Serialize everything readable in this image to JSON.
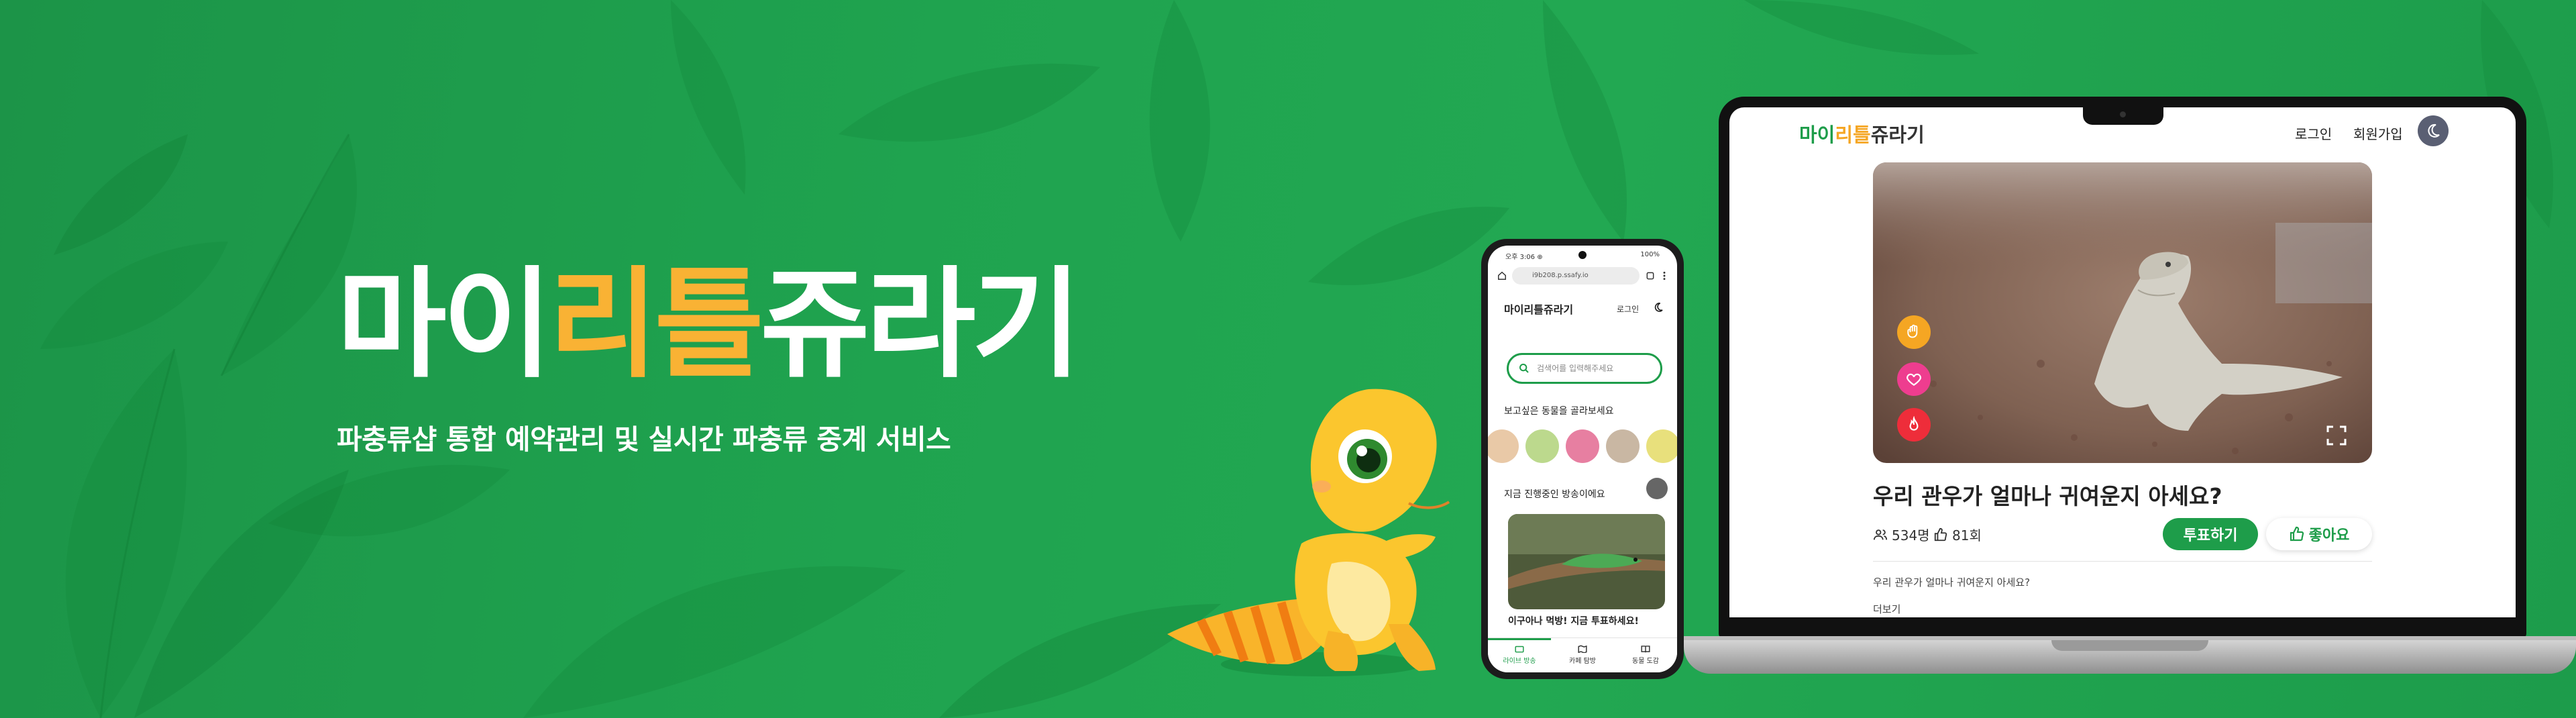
{
  "hero": {
    "title_part1": "마이",
    "title_part2": "리틀",
    "title_part3": "쥬라기",
    "subtitle": "파충류샵 통합 예약관리 및 실시간 파충류 중계 서비스"
  },
  "laptop": {
    "logo": {
      "p1": "마이",
      "p2": "리틀",
      "p3": "쥬라기"
    },
    "nav": {
      "login": "로그인",
      "signup": "회원가입"
    },
    "theme_icon": "moon-icon",
    "reaction_icons": [
      "hand-icon",
      "heart-icon",
      "fire-icon"
    ],
    "post": {
      "title": "우리 관우가 얼마나 귀여운지 아세요?",
      "viewers": "534명",
      "likes": "81회",
      "vote_label": "투표하기",
      "like_label": "좋아요",
      "description": "우리 관우가 얼마나 귀여운지 아세요?",
      "more": "더보기"
    }
  },
  "phone": {
    "status_left": "오후 3:06 ⊕",
    "status_right": "100%",
    "url": "i9b208.p.ssafy.io",
    "logo": "마이리틀쥬라기",
    "login": "로그인",
    "search_placeholder": "검색어를 입력해주세요",
    "animals_heading": "보고싶은 동물을 골라보세요",
    "live_heading": "지금 진행중인 방송이에요",
    "live_card_title": "이구아나 먹방! 지금 투표하세요!",
    "nav": [
      "라이브 방송",
      "카페 탐방",
      "동물 도감"
    ]
  },
  "colors": {
    "brand_green": "#1e9d4a",
    "brand_orange": "#f9b234",
    "background_green": "#1fa34f",
    "pink_accent": "#ee3d8f"
  }
}
